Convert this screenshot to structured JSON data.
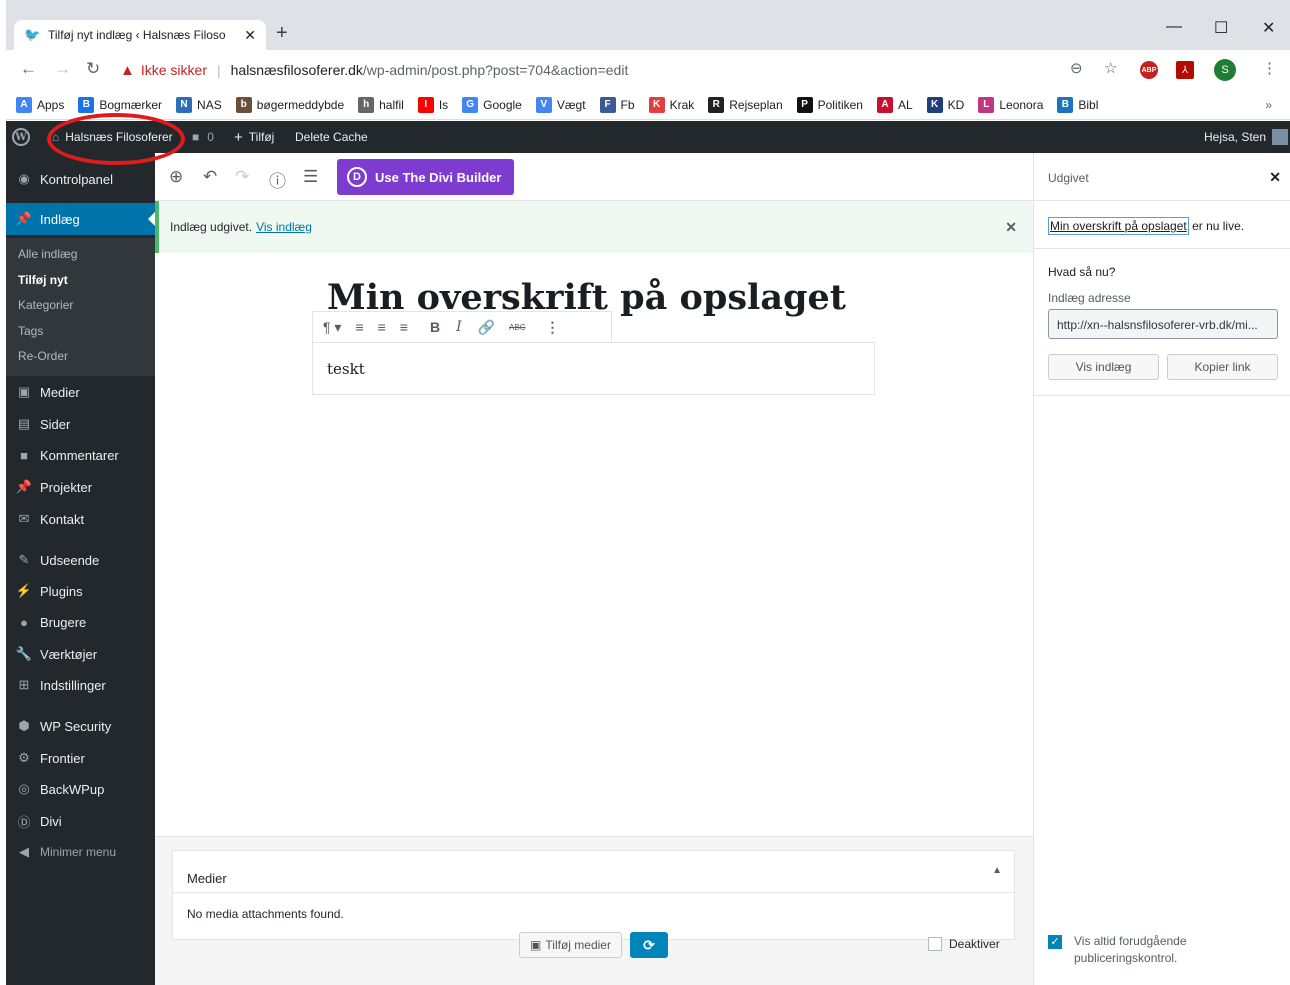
{
  "browser": {
    "tab_title": "Tilføj nyt indlæg ‹ Halsnæs Filoso",
    "new_tab": "+",
    "window_controls": [
      "—",
      "☐",
      "✕"
    ],
    "insecure_label": "Ikke sikker",
    "url_host": "halsnæsfilosoferer.dk",
    "url_path": "/wp-admin/post.php?post=704&action=edit",
    "profile_initial": "S",
    "abp_label": "ABP",
    "bookmarks": [
      {
        "label": "Apps",
        "icon": "apps-grid-icon",
        "color": "#4285f4"
      },
      {
        "label": "Bogmærker",
        "icon": "star-icon",
        "color": "#1a73e8"
      },
      {
        "label": "NAS",
        "icon": "dsm-icon",
        "color": "#2c6fb7"
      },
      {
        "label": "bøgermeddybde",
        "icon": "book-thumb-icon",
        "color": "#6b4f3a"
      },
      {
        "label": "halfil",
        "icon": "halfil-icon",
        "color": "#666666"
      },
      {
        "label": "Is",
        "icon": "youtube-icon",
        "color": "#ff0000"
      },
      {
        "label": "Google",
        "icon": "google-icon",
        "color": "#4285f4"
      },
      {
        "label": "Vægt",
        "icon": "docs-icon",
        "color": "#4285f4"
      },
      {
        "label": "Fb",
        "icon": "facebook-icon",
        "color": "#3b5998"
      },
      {
        "label": "Krak",
        "icon": "krak-icon",
        "color": "#e43d3d"
      },
      {
        "label": "Rejseplan",
        "icon": "rejseplan-icon",
        "color": "#222222"
      },
      {
        "label": "Politiken",
        "icon": "politiken-icon",
        "color": "#111111"
      },
      {
        "label": "AL",
        "icon": "al-icon",
        "color": "#c8102e"
      },
      {
        "label": "KD",
        "icon": "kd-icon",
        "color": "#1f3e7a"
      },
      {
        "label": "Leonora",
        "icon": "instagram-icon",
        "color": "#c13584"
      },
      {
        "label": "Bibl",
        "icon": "bibl-icon",
        "color": "#1b75bb"
      }
    ],
    "bookmarks_more": "»"
  },
  "adminbar": {
    "site_name": "Halsnæs Filosoferer",
    "comments_count": "0",
    "new_label": "Tilføj",
    "cache_label": "Delete Cache",
    "greeting": "Hejsa, Sten"
  },
  "sidebar": {
    "items": [
      {
        "label": "Kontrolpanel",
        "icon": "dashboard-icon",
        "glyph": "◉"
      },
      {
        "label": "Indlæg",
        "icon": "pushpin-icon",
        "glyph": "📌"
      },
      {
        "label": "Medier",
        "icon": "media-icon",
        "glyph": "▣"
      },
      {
        "label": "Sider",
        "icon": "pages-icon",
        "glyph": "▤"
      },
      {
        "label": "Kommentarer",
        "icon": "comment-icon",
        "glyph": "■"
      },
      {
        "label": "Projekter",
        "icon": "pushpin-icon",
        "glyph": "📌"
      },
      {
        "label": "Kontakt",
        "icon": "mail-icon",
        "glyph": "✉"
      },
      {
        "label": "Udseende",
        "icon": "brush-icon",
        "glyph": "✎"
      },
      {
        "label": "Plugins",
        "icon": "plugin-icon",
        "glyph": "⚡"
      },
      {
        "label": "Brugere",
        "icon": "users-icon",
        "glyph": "●"
      },
      {
        "label": "Værktøjer",
        "icon": "wrench-icon",
        "glyph": "🔧"
      },
      {
        "label": "Indstillinger",
        "icon": "settings-icon",
        "glyph": "⊞"
      },
      {
        "label": "WP Security",
        "icon": "shield-icon",
        "glyph": "⬢"
      },
      {
        "label": "Frontier",
        "icon": "gear-icon",
        "glyph": "⚙"
      },
      {
        "label": "BackWPup",
        "icon": "backwpup-icon",
        "glyph": "◎"
      },
      {
        "label": "Divi",
        "icon": "divi-icon",
        "glyph": "Ⓓ"
      },
      {
        "label": "Minimer menu",
        "icon": "collapse-icon",
        "glyph": "◀"
      }
    ],
    "submenu": [
      "Alle indlæg",
      "Tilføj nyt",
      "Kategorier",
      "Tags",
      "Re-Order"
    ]
  },
  "editor": {
    "divi_button": "Use The Divi Builder",
    "divi_logo": "D",
    "notice_text": "Indlæg udgivet.",
    "notice_link": "Vis indlæg",
    "post_title": "Min overskrift på opslaget",
    "paragraph_text": "teskt",
    "media_title": "Medier",
    "media_empty": "No media attachments found.",
    "add_media": "Tilføj medier",
    "deactivate": "Deaktiver"
  },
  "panel": {
    "title": "Udgivet",
    "live_link": "Min overskrift på opslaget",
    "live_suffix": " er nu live.",
    "next_heading": "Hvad så nu?",
    "address_label": "Indlæg adresse",
    "address_value": "http://xn--halsnsfilosoferer-vrb.dk/mi...",
    "view_button": "Vis indlæg",
    "copy_button": "Kopier link",
    "always_show": "Vis altid forudgående publiceringskontrol."
  },
  "colors": {
    "wp_dark": "#23282d",
    "wp_blue": "#0073aa",
    "divi_purple": "#7e3bd0",
    "success_green": "#4ab866",
    "annotation_red": "#e01b1b"
  }
}
